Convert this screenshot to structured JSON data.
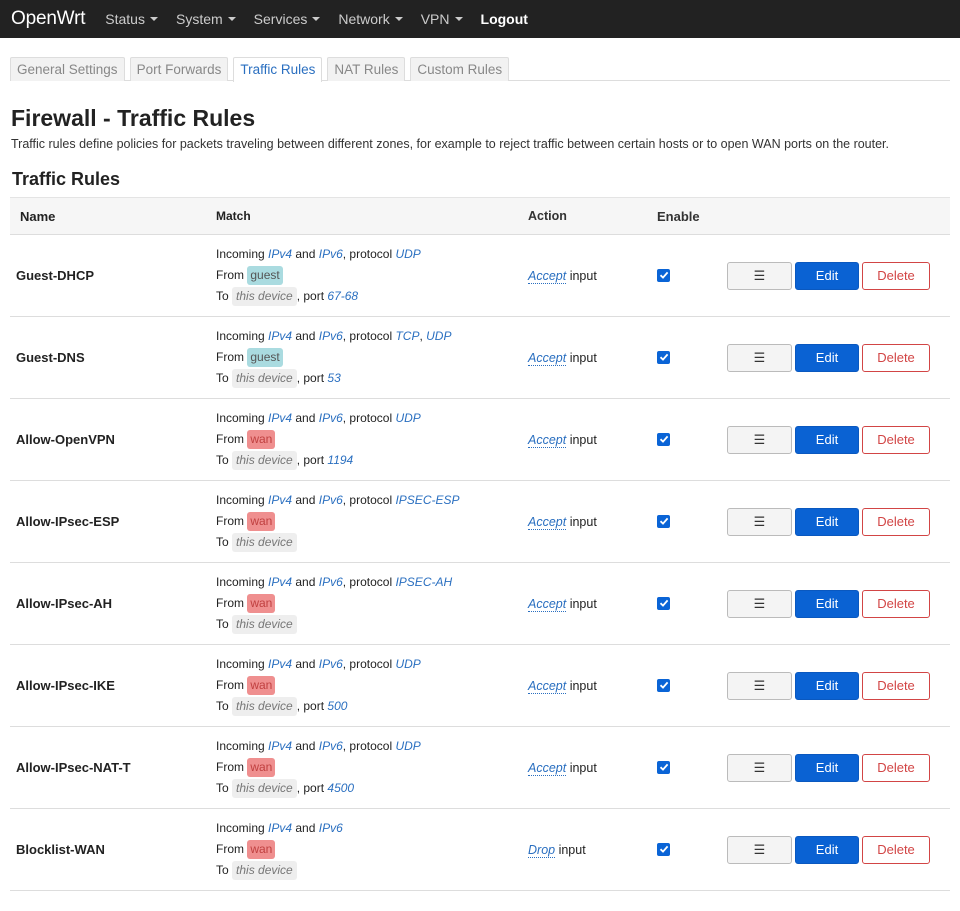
{
  "nav": {
    "brand": "OpenWrt",
    "items": [
      {
        "label": "Status",
        "caret": true
      },
      {
        "label": "System",
        "caret": true
      },
      {
        "label": "Services",
        "caret": true
      },
      {
        "label": "Network",
        "caret": true
      },
      {
        "label": "VPN",
        "caret": true
      }
    ],
    "logout": "Logout"
  },
  "tabs": [
    {
      "label": "General Settings",
      "active": false
    },
    {
      "label": "Port Forwards",
      "active": false
    },
    {
      "label": "Traffic Rules",
      "active": true
    },
    {
      "label": "NAT Rules",
      "active": false
    },
    {
      "label": "Custom Rules",
      "active": false
    }
  ],
  "page": {
    "title": "Firewall - Traffic Rules",
    "description": "Traffic rules define policies for packets traveling between different zones, for example to reject traffic between certain hosts or to open WAN ports on the router.",
    "section_title": "Traffic Rules"
  },
  "table": {
    "headers": {
      "name": "Name",
      "match": "Match",
      "action": "Action",
      "enable": "Enable"
    },
    "labels": {
      "incoming": "Incoming",
      "and": "and",
      "protocol": ", protocol",
      "from": "From",
      "to": "To",
      "port": ", port",
      "input": "input",
      "comma": ","
    },
    "buttons": {
      "drag": "☰",
      "edit": "Edit",
      "delete": "Delete"
    },
    "rows": [
      {
        "name": "Guest-DHCP",
        "family": [
          "IPv4",
          "IPv6"
        ],
        "protocols": [
          "UDP"
        ],
        "from": "guest",
        "from_color": "guest",
        "to": "this device",
        "port": "67-68",
        "action": "Accept",
        "enabled": true
      },
      {
        "name": "Guest-DNS",
        "family": [
          "IPv4",
          "IPv6"
        ],
        "protocols": [
          "TCP",
          "UDP"
        ],
        "from": "guest",
        "from_color": "guest",
        "to": "this device",
        "port": "53",
        "action": "Accept",
        "enabled": true
      },
      {
        "name": "Allow-OpenVPN",
        "family": [
          "IPv4",
          "IPv6"
        ],
        "protocols": [
          "UDP"
        ],
        "from": "wan",
        "from_color": "wan",
        "to": "this device",
        "port": "1194",
        "action": "Accept",
        "enabled": true
      },
      {
        "name": "Allow-IPsec-ESP",
        "family": [
          "IPv4",
          "IPv6"
        ],
        "protocols": [
          "IPSEC-ESP"
        ],
        "from": "wan",
        "from_color": "wan",
        "to": "this device",
        "port": "",
        "action": "Accept",
        "enabled": true
      },
      {
        "name": "Allow-IPsec-AH",
        "family": [
          "IPv4",
          "IPv6"
        ],
        "protocols": [
          "IPSEC-AH"
        ],
        "from": "wan",
        "from_color": "wan",
        "to": "this device",
        "port": "",
        "action": "Accept",
        "enabled": true
      },
      {
        "name": "Allow-IPsec-IKE",
        "family": [
          "IPv4",
          "IPv6"
        ],
        "protocols": [
          "UDP"
        ],
        "from": "wan",
        "from_color": "wan",
        "to": "this device",
        "port": "500",
        "action": "Accept",
        "enabled": true
      },
      {
        "name": "Allow-IPsec-NAT-T",
        "family": [
          "IPv4",
          "IPv6"
        ],
        "protocols": [
          "UDP"
        ],
        "from": "wan",
        "from_color": "wan",
        "to": "this device",
        "port": "4500",
        "action": "Accept",
        "enabled": true
      },
      {
        "name": "Blocklist-WAN",
        "family": [
          "IPv4",
          "IPv6"
        ],
        "protocols": [],
        "from": "wan",
        "from_color": "wan",
        "to": "this device",
        "port": "",
        "action": "Drop",
        "enabled": true
      }
    ]
  },
  "colors": {
    "navbar": "#222222",
    "link": "#2a6fc0",
    "edit_button": "#0a62d3",
    "delete_button": "#d24545",
    "zone_guest": "#aadbe0",
    "zone_wan": "#ef8f8f"
  }
}
